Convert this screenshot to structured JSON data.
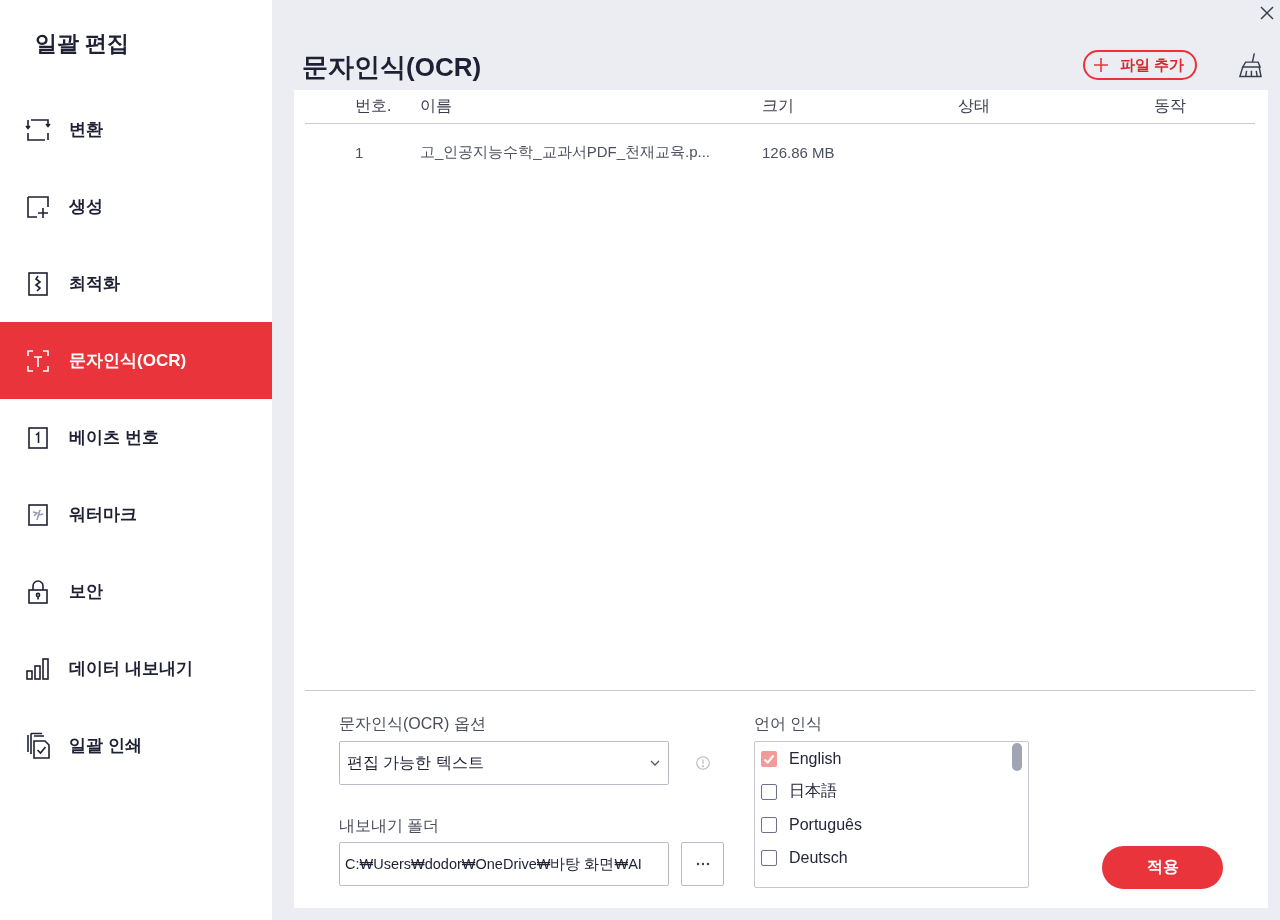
{
  "sidebar": {
    "title": "일괄 편집",
    "items": [
      {
        "kind": "convert",
        "label": "변환",
        "selected": false
      },
      {
        "kind": "create",
        "label": "생성",
        "selected": false
      },
      {
        "kind": "optimize",
        "label": "최적화",
        "selected": false
      },
      {
        "kind": "ocr",
        "label": "문자인식(OCR)",
        "selected": true
      },
      {
        "kind": "bates",
        "label": "베이츠 번호",
        "selected": false
      },
      {
        "kind": "watermark",
        "label": "워터마크",
        "selected": false
      },
      {
        "kind": "security",
        "label": "보안",
        "selected": false
      },
      {
        "kind": "export",
        "label": "데이터 내보내기",
        "selected": false
      },
      {
        "kind": "print",
        "label": "일괄 인쇄",
        "selected": false
      }
    ]
  },
  "header": {
    "title": "문자인식(OCR)",
    "add_button": "파일 추가"
  },
  "table": {
    "columns": [
      "번호.",
      "이름",
      "크기",
      "상태",
      "동작"
    ],
    "rows": [
      {
        "cells": [
          "1",
          "고_인공지능수학_교과서PDF_천재교육.p...",
          "126.86 MB"
        ]
      }
    ]
  },
  "ocr_option": {
    "label": "문자인식(OCR) 옵션",
    "value": "편집 가능한 텍스트"
  },
  "export_folder": {
    "label": "내보내기 폴더",
    "value": "C:₩Users₩dodor₩OneDrive₩바탕 화면₩AI"
  },
  "language": {
    "label": "언어 인식",
    "items": [
      {
        "label": "English",
        "checked": true
      },
      {
        "label": "日本語",
        "checked": false
      },
      {
        "label": "Português",
        "checked": false
      },
      {
        "label": "Deutsch",
        "checked": false
      }
    ]
  },
  "apply_button": "적용"
}
